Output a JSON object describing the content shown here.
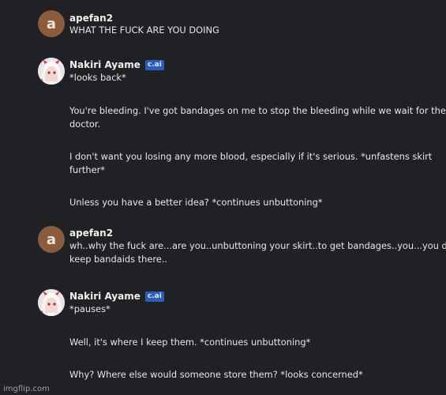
{
  "messages": [
    {
      "author": "apefan2",
      "avatar_letter": "a",
      "lines": [
        "WHAT THE FUCK ARE YOU DOING"
      ]
    },
    {
      "author": "Nakiri Ayame",
      "badge": "c.ai",
      "lines": [
        "*looks back*",
        "You're bleeding. I've got bandages on me to stop the bleeding while we wait for the",
        "doctor.",
        "I don't want you losing any more blood, especially if it's serious. *unfastens skirt",
        "further*",
        "Unless you have a better idea? *continues unbuttoning*"
      ]
    },
    {
      "author": "apefan2",
      "avatar_letter": "a",
      "lines": [
        "wh..why the fuck are...are you..unbuttoning your skirt..to get bandages..you...you don't",
        "keep bandaids there.."
      ]
    },
    {
      "author": "Nakiri Ayame",
      "badge": "c.ai",
      "lines": [
        "*pauses*",
        "Well, it's where I keep them. *continues unbuttoning*",
        "Why? Where else would someone store them? *looks concerned*"
      ]
    }
  ],
  "watermark": "imgflip.com",
  "colors": {
    "background": "#202124",
    "user_avatar": "#8a5c3c",
    "badge": "#2b5dbd"
  }
}
